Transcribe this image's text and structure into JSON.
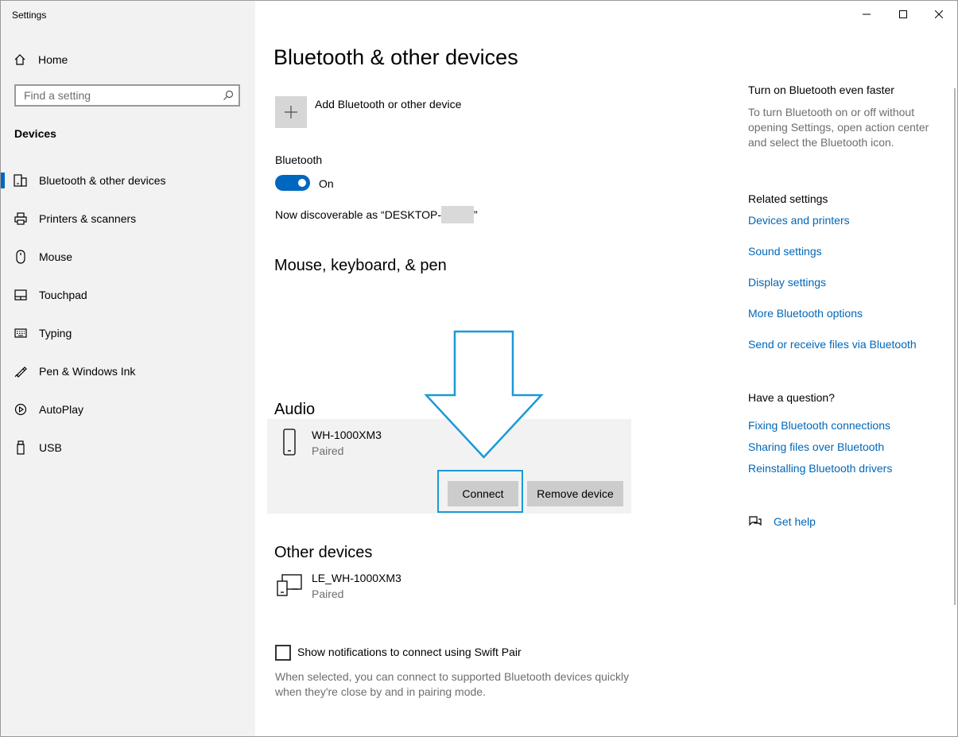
{
  "window": {
    "app_title": "Settings",
    "controls": {
      "minimize": "minimize-icon",
      "maximize": "maximize-icon",
      "close": "close-icon"
    }
  },
  "sidebar": {
    "home_label": "Home",
    "search_placeholder": "Find a setting",
    "section_title": "Devices",
    "items": [
      {
        "label": "Bluetooth & other devices",
        "icon": "bluetooth-devices-icon",
        "active": true
      },
      {
        "label": "Printers & scanners",
        "icon": "printer-icon",
        "active": false
      },
      {
        "label": "Mouse",
        "icon": "mouse-icon",
        "active": false
      },
      {
        "label": "Touchpad",
        "icon": "touchpad-icon",
        "active": false
      },
      {
        "label": "Typing",
        "icon": "keyboard-icon",
        "active": false
      },
      {
        "label": "Pen & Windows Ink",
        "icon": "pen-icon",
        "active": false
      },
      {
        "label": "AutoPlay",
        "icon": "autoplay-icon",
        "active": false
      },
      {
        "label": "USB",
        "icon": "usb-icon",
        "active": false
      }
    ],
    "accent_color": "#0067c0"
  },
  "main": {
    "title": "Bluetooth & other devices",
    "add_device_label": "Add Bluetooth or other device",
    "bluetooth_label": "Bluetooth",
    "toggle_state": "On",
    "discoverable_prefix": "Now discoverable as “DESKTOP-",
    "discoverable_suffix": "”",
    "section_mouse": "Mouse, keyboard, & pen",
    "section_audio": "Audio",
    "audio_device": {
      "name": "WH-1000XM3",
      "status": "Paired",
      "icon": "headset-phone-icon"
    },
    "connect_label": "Connect",
    "remove_label": "Remove device",
    "section_other": "Other devices",
    "other_device": {
      "name": "LE_WH-1000XM3",
      "status": "Paired",
      "icon": "generic-device-icon"
    },
    "swift_pair_label": "Show notifications to connect using Swift Pair",
    "swift_pair_desc": "When selected, you can connect to supported Bluetooth devices quickly when they're close by and in pairing mode."
  },
  "right": {
    "faster_title": "Turn on Bluetooth even faster",
    "faster_text": "To turn Bluetooth on or off without opening Settings, open action center and select the Bluetooth icon.",
    "related_title": "Related settings",
    "related_links": [
      "Devices and printers",
      "Sound settings",
      "Display settings",
      "More Bluetooth options",
      "Send or receive files via Bluetooth"
    ],
    "question_title": "Have a question?",
    "question_links": [
      "Fixing Bluetooth connections",
      "Sharing files over Bluetooth",
      "Reinstalling Bluetooth drivers"
    ],
    "get_help": "Get help",
    "link_color": "#0067b8"
  },
  "annotation": {
    "highlight_color": "#1a9ad6"
  }
}
